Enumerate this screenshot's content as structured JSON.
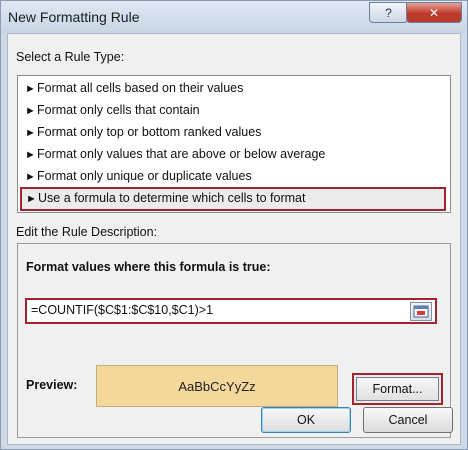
{
  "window": {
    "title": "New Formatting Rule",
    "help_glyph": "?",
    "close_glyph": "✕"
  },
  "rule_type": {
    "label": "Select a Rule Type:",
    "items": [
      "Format all cells based on their values",
      "Format only cells that contain",
      "Format only top or bottom ranked values",
      "Format only values that are above or below average",
      "Format only unique or duplicate values",
      "Use a formula to determine which cells to format"
    ],
    "selected_index": 5
  },
  "description": {
    "label": "Edit the Rule Description:",
    "formula_label": "Format values where this formula is true:",
    "formula_value": "=COUNTIF($C$1:$C$10,$C1)>1",
    "preview_label": "Preview:",
    "preview_text": "AaBbCcYyZz",
    "preview_color": "#f3d79b",
    "format_button": "Format..."
  },
  "buttons": {
    "ok": "OK",
    "cancel": "Cancel"
  },
  "accent_highlight": "#a3232c"
}
